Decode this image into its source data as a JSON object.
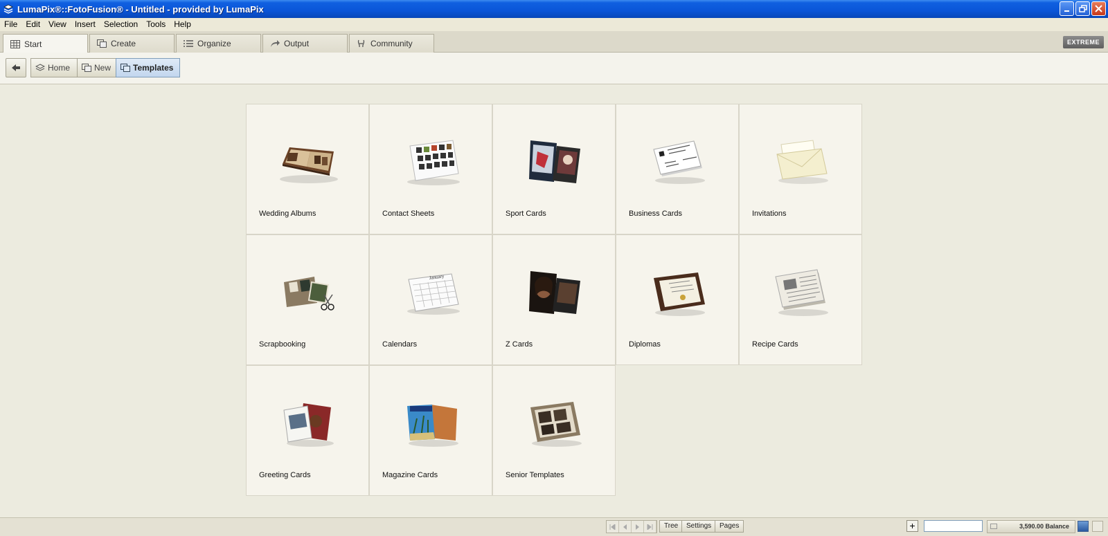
{
  "window": {
    "title": "LumaPix®::FotoFusion® - Untitled - provided by LumaPix"
  },
  "menu": [
    "File",
    "Edit",
    "View",
    "Insert",
    "Selection",
    "Tools",
    "Help"
  ],
  "tabs": [
    {
      "label": "Start",
      "icon": "grid-icon",
      "active": true
    },
    {
      "label": "Create",
      "icon": "create-icon",
      "active": false
    },
    {
      "label": "Organize",
      "icon": "list-icon",
      "active": false
    },
    {
      "label": "Output",
      "icon": "share-arrow-icon",
      "active": false
    },
    {
      "label": "Community",
      "icon": "community-icon",
      "active": false
    }
  ],
  "edition_badge": "EXTREME",
  "subnav": {
    "back_icon": "back-arrow-icon",
    "items": [
      {
        "label": "Home",
        "icon": "layers-icon",
        "active": false
      },
      {
        "label": "New",
        "icon": "new-doc-icon",
        "active": false
      },
      {
        "label": "Templates",
        "icon": "templates-icon",
        "active": true
      }
    ]
  },
  "templates": [
    {
      "label": "Wedding Albums",
      "thumb": "wedding-album-thumb"
    },
    {
      "label": "Contact Sheets",
      "thumb": "contact-sheet-thumb"
    },
    {
      "label": "Sport Cards",
      "thumb": "sport-cards-thumb"
    },
    {
      "label": "Business Cards",
      "thumb": "business-cards-thumb"
    },
    {
      "label": "Invitations",
      "thumb": "invitation-thumb"
    },
    {
      "label": "Scrapbooking",
      "thumb": "scrapbook-thumb"
    },
    {
      "label": "Calendars",
      "thumb": "calendar-thumb"
    },
    {
      "label": "Z Cards",
      "thumb": "z-cards-thumb"
    },
    {
      "label": "Diplomas",
      "thumb": "diploma-thumb"
    },
    {
      "label": "Recipe Cards",
      "thumb": "recipe-cards-thumb"
    },
    {
      "label": "Greeting Cards",
      "thumb": "greeting-cards-thumb"
    },
    {
      "label": "Magazine Cards",
      "thumb": "magazine-cards-thumb"
    },
    {
      "label": "Senior Templates",
      "thumb": "senior-templates-thumb"
    }
  ],
  "calendar_month": "January",
  "statusbar": {
    "buttons": [
      "Tree",
      "Settings",
      "Pages"
    ],
    "plus": "+",
    "balance": "3,590.00 Balance"
  },
  "colors": {
    "titlebar": "#0a55d8",
    "background": "#ecebdf",
    "card": "#f6f4ec",
    "active_segment": "#c2d6ee"
  }
}
